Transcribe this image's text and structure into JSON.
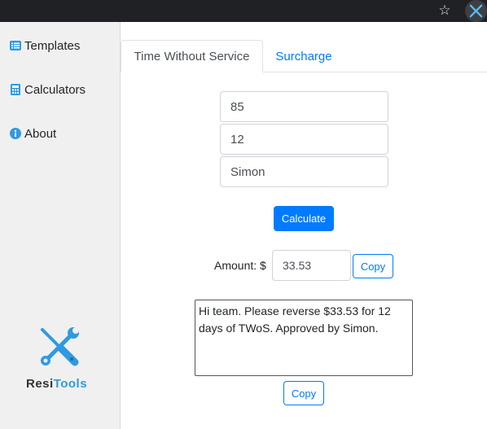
{
  "sidebar": {
    "items": [
      {
        "label": "Templates",
        "icon": "list-icon"
      },
      {
        "label": "Calculators",
        "icon": "calculator-icon"
      },
      {
        "label": "About",
        "icon": "info-icon"
      }
    ],
    "brand": {
      "part1": "Resi",
      "part2": "Tools"
    }
  },
  "tabs": [
    {
      "label": "Time Without Service",
      "active": true
    },
    {
      "label": "Surcharge",
      "active": false
    }
  ],
  "form": {
    "field1": "85",
    "field2": "12",
    "field3": "Simon",
    "calculate_label": "Calculate",
    "amount_label": "Amount: $",
    "amount_value": "33.53",
    "copy_label": "Copy",
    "message": "Hi team. Please reverse $33.53 for 12 days of TWoS. Approved by Simon.",
    "copy_message_label": "Copy"
  },
  "colors": {
    "accent": "#007bff",
    "brand_blue": "#2f9ae0",
    "sidebar_bg": "#f0f0f0",
    "chrome_bg": "#202124"
  }
}
